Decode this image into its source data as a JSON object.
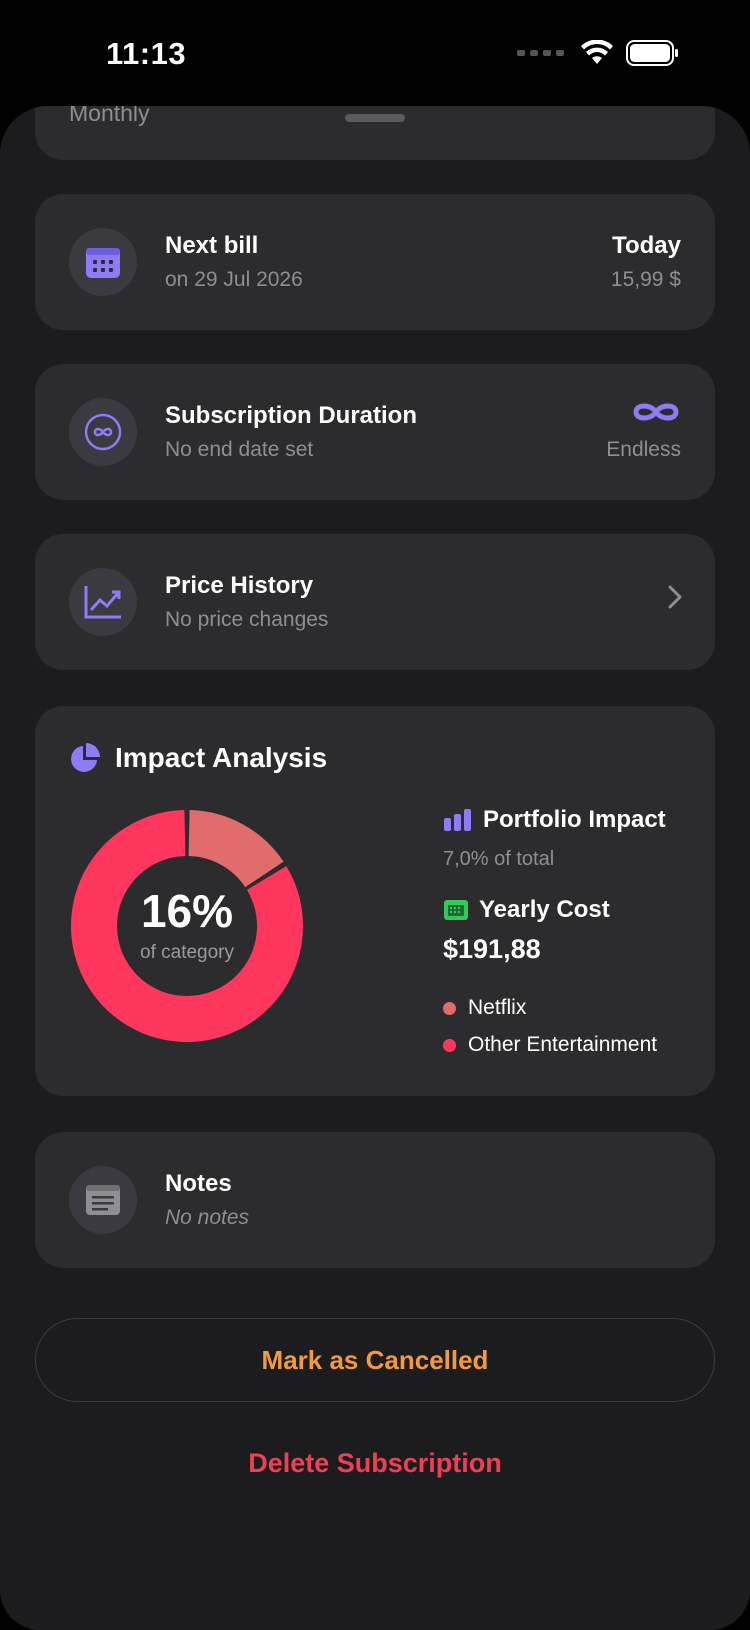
{
  "status_bar": {
    "time": "11:13"
  },
  "top_card": {
    "label": "Monthly"
  },
  "next_bill": {
    "title": "Next bill",
    "date": "on 29 Jul 2026",
    "due": "Today",
    "amount": "15,99 $"
  },
  "duration": {
    "title": "Subscription Duration",
    "subtitle": "No end date set",
    "value": "Endless"
  },
  "price_history": {
    "title": "Price History",
    "subtitle": "No price changes"
  },
  "impact": {
    "title": "Impact Analysis",
    "percent": "16%",
    "percent_caption": "of category",
    "portfolio_title": "Portfolio Impact",
    "portfolio_sub": "7,0% of total",
    "yearly_title": "Yearly Cost",
    "yearly_value": "$191,88",
    "legend": [
      {
        "label": "Netflix",
        "color": "#e06c6c"
      },
      {
        "label": "Other Entertainment",
        "color": "#ff375f"
      }
    ],
    "share_fraction": 0.16
  },
  "notes": {
    "title": "Notes",
    "subtitle": "No notes"
  },
  "actions": {
    "cancel_label": "Mark as Cancelled",
    "delete_label": "Delete Subscription"
  },
  "colors": {
    "accent": "#8e7cf6",
    "warning": "#f39a3c",
    "danger": "#f03e55",
    "green": "#34c759"
  }
}
